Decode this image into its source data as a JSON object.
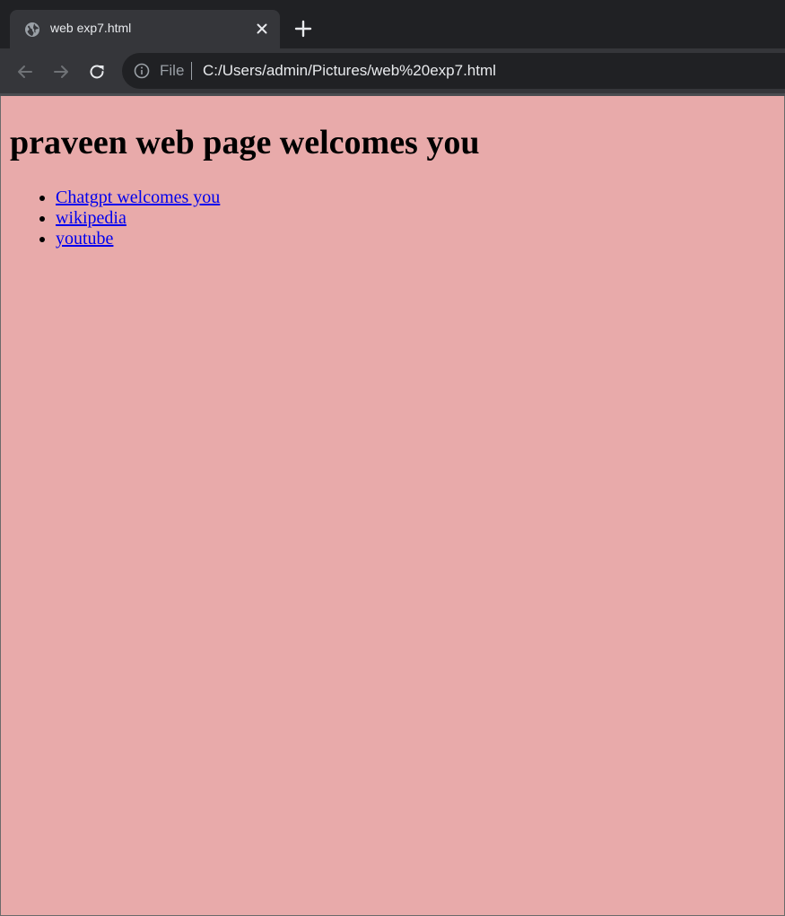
{
  "browser": {
    "tab": {
      "title": "web exp7.html",
      "icon": "globe-icon"
    },
    "toolbar": {
      "scheme_label": "File",
      "url": "C:/Users/admin/Pictures/web%20exp7.html"
    },
    "colors": {
      "tabstrip_bg": "#202124",
      "tab_bg": "#35363a",
      "omnibox_bg": "#202124",
      "text": "#e8eaed"
    }
  },
  "page": {
    "background": "#e8aaaa",
    "heading": "praveen web page welcomes you",
    "links": [
      {
        "label": "Chatgpt welcomes you"
      },
      {
        "label": "wikipedia"
      },
      {
        "label": "youtube"
      }
    ],
    "link_color": "#0000ee"
  }
}
